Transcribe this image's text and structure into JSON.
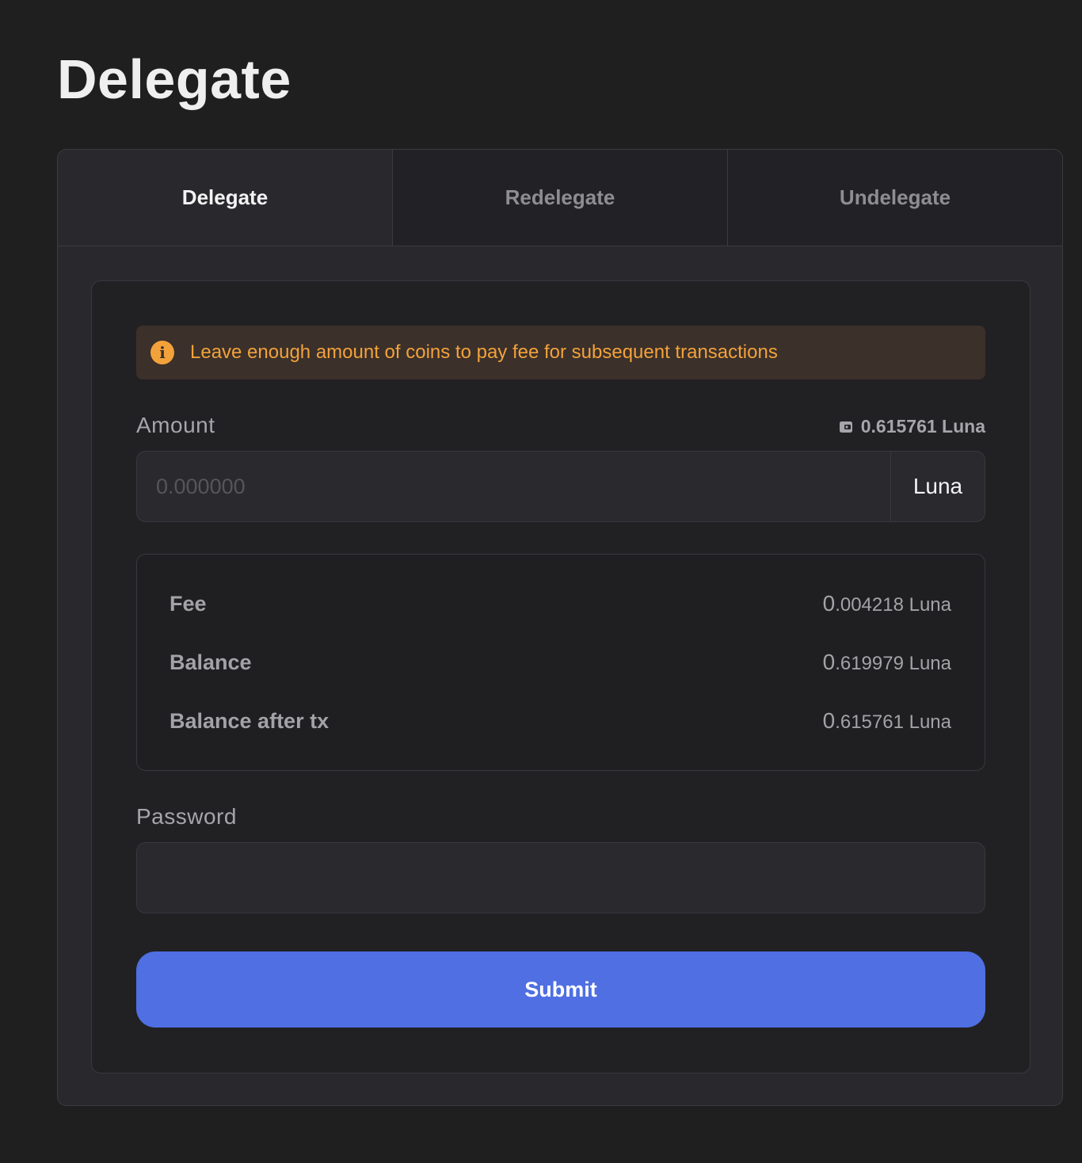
{
  "page": {
    "title": "Delegate"
  },
  "tabs": [
    {
      "label": "Delegate",
      "active": true
    },
    {
      "label": "Redelegate",
      "active": false
    },
    {
      "label": "Undelegate",
      "active": false
    }
  ],
  "warning": {
    "icon": "info-icon",
    "text": "Leave enough amount of coins to pay fee for subsequent transactions",
    "color": "#f3a23b"
  },
  "amount": {
    "label": "Amount",
    "available_icon": "wallet-icon",
    "available": "0.615761 Luna",
    "placeholder": "0.000000",
    "value": "",
    "unit": "Luna"
  },
  "summary": {
    "fee": {
      "label": "Fee",
      "int": "0",
      "rest": ".004218 Luna"
    },
    "balance": {
      "label": "Balance",
      "int": "0",
      "rest": ".619979 Luna"
    },
    "balance_after": {
      "label": "Balance after tx",
      "int": "0",
      "rest": ".615761 Luna"
    }
  },
  "password": {
    "label": "Password",
    "value": ""
  },
  "submit": {
    "label": "Submit",
    "color": "#4f6fe2"
  }
}
